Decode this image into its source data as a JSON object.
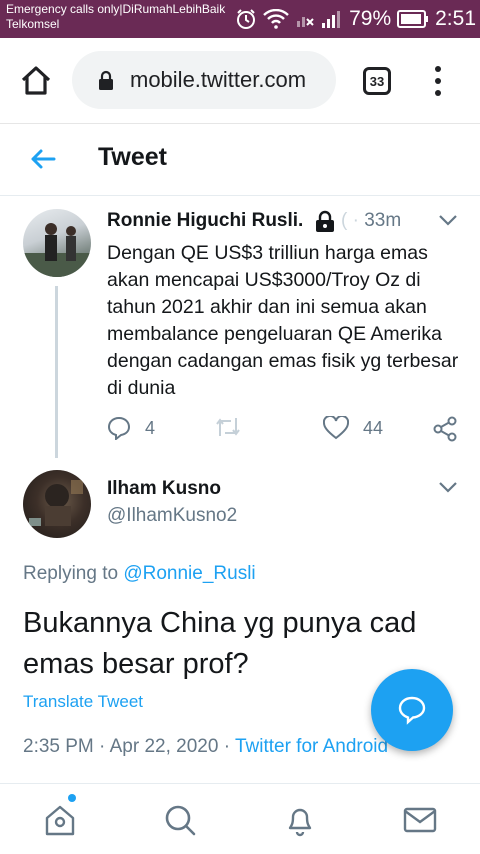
{
  "status_bar": {
    "line1": "Emergency calls only|DiRumahLebihBaik",
    "line2": "Telkomsel",
    "battery": "79%",
    "time": "2:51"
  },
  "browser": {
    "url": "mobile.twitter.com",
    "tab_count": "33"
  },
  "header": {
    "title": "Tweet"
  },
  "parent_tweet": {
    "name": "Ronnie Higuchi Rusli.",
    "time_ago": "33m",
    "text": "Dengan QE US$3 trilliun harga emas akan mencapai US$3000/Troy Oz di tahun 2021 akhir dan ini semua akan membalance pengeluaran QE Amerika dengan cadangan emas fisik yg terbesar di dunia",
    "reply_count": "4",
    "like_count": "44"
  },
  "main_tweet": {
    "name": "Ilham Kusno",
    "handle": "@IlhamKusno2",
    "replying_label": "Replying to",
    "replying_to": "@Ronnie_Rusli",
    "text": "Bukannya China yg punya cad emas besar prof?",
    "translate": "Translate Tweet",
    "timestamp": "2:35 PM · Apr 22, 2020",
    "separator": "·",
    "source": "Twitter for Android"
  },
  "colors": {
    "accent": "#1da1f2",
    "status_bar": "#6a2a55",
    "secondary_text": "#657786"
  },
  "icons": [
    "home-icon",
    "lock-icon",
    "tabs-icon",
    "menu-icon",
    "back-arrow-icon",
    "chevron-down-icon",
    "reply-icon",
    "retweet-icon",
    "like-icon",
    "share-icon",
    "compose-icon",
    "explore-icon",
    "search-icon",
    "notifications-icon",
    "messages-icon"
  ]
}
